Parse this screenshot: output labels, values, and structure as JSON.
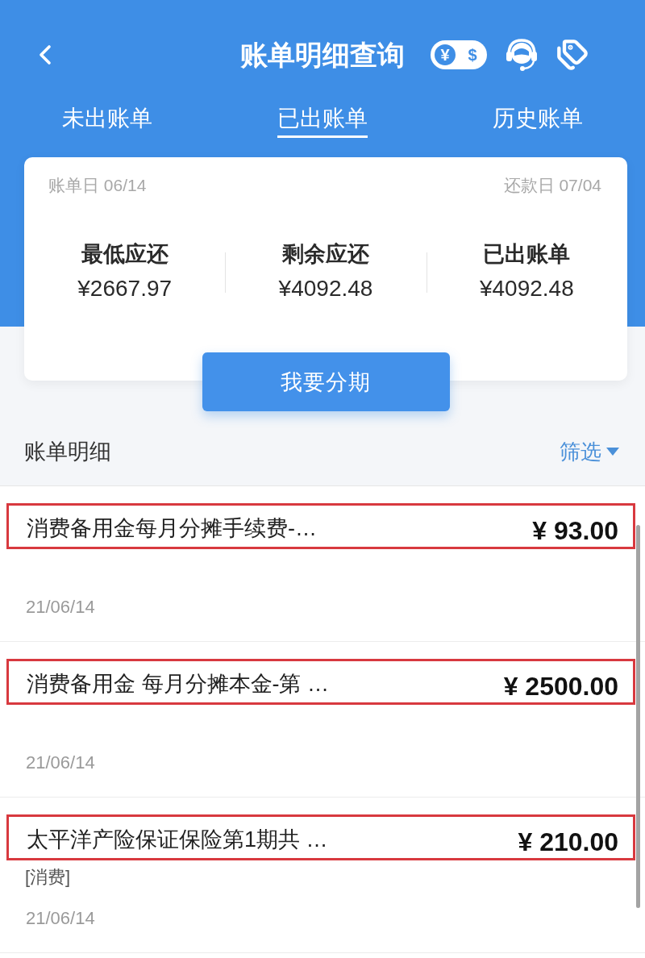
{
  "header": {
    "title": "账单明细查询",
    "currency_toggle": [
      {
        "label": "¥",
        "selected": true
      },
      {
        "label": "$",
        "selected": false
      }
    ]
  },
  "tabs": [
    {
      "label": "未出账单",
      "selected": false
    },
    {
      "label": "已出账单",
      "selected": true
    },
    {
      "label": "历史账单",
      "selected": false
    }
  ],
  "statement_card": {
    "bill_date": "账单日 06/14",
    "due_date": "还款日 07/04",
    "summary": [
      {
        "label": "最低应还",
        "amount": "¥2667.97"
      },
      {
        "label": "剩余应还",
        "amount": "¥4092.48"
      },
      {
        "label": "已出账单",
        "amount": "¥4092.48"
      }
    ],
    "button": "我要分期"
  },
  "details": {
    "title": "账单明细",
    "filter": "筛选"
  },
  "transactions": [
    {
      "title": "消费备用金每月分摊手续费-…",
      "amount": "¥ 93.00",
      "date": "21/06/14",
      "highlighted": true
    },
    {
      "title": "消费备用金 每月分摊本金-第 …",
      "amount": "¥ 2500.00",
      "date": "21/06/14",
      "highlighted": true
    },
    {
      "title": "太平洋产险保证保险第1期共 …",
      "subtitle": "[消费]",
      "amount": "¥ 210.00",
      "date": "21/06/14",
      "highlighted": true
    }
  ]
}
